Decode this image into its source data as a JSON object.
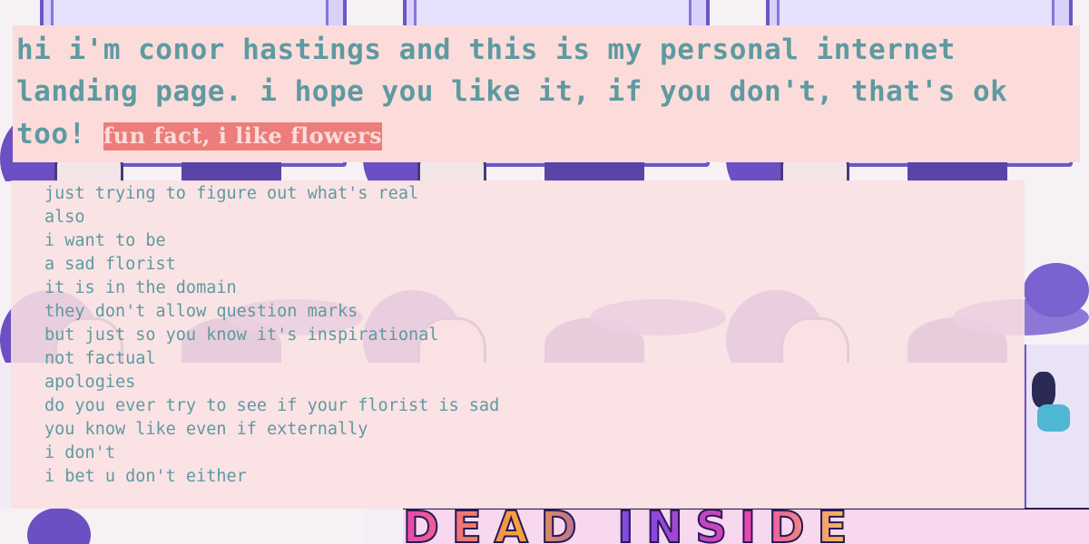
{
  "header": {
    "intro": "hi i'm conor hastings and this is my personal internet landing page. i hope you like it, if you don't, that's ok too!",
    "fun_fact": "fun fact, i like flowers"
  },
  "poem": {
    "lines": [
      "just trying to figure out what's real",
      "also",
      "i want to be",
      "a sad florist",
      "it is in the domain",
      "they don't allow question marks",
      "but just so you know it's inspirational",
      "not factual",
      "apologies",
      "do you ever try to see if your florist is sad",
      "you know like even if externally",
      "i don't",
      "i bet u don't either"
    ]
  },
  "background": {
    "banner_text": "DEAD INSIDE",
    "icons": [
      "sad-florist-illustration"
    ]
  },
  "colors": {
    "header_bg": "#fcdcdb",
    "text_teal": "#5e9aa0",
    "fun_fact_bg": "#ec7d7a",
    "poem_bg": "#fbe0e2",
    "frame_purple": "#6f55c4"
  }
}
